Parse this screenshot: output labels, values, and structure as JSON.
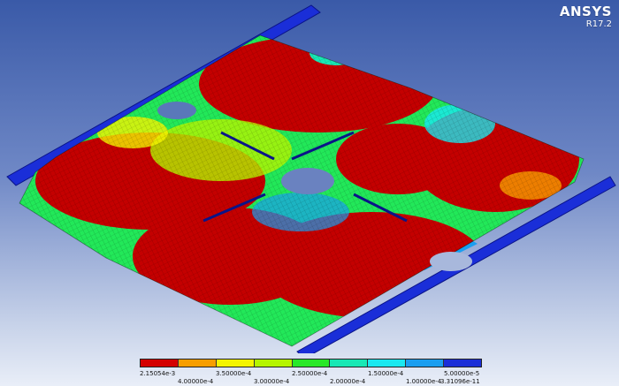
{
  "brand": {
    "name": "ANSYS",
    "version": "R17.2"
  },
  "view": {
    "icon": "fea-contour-plot"
  },
  "legend": {
    "colors": [
      "#d40000",
      "#f79e00",
      "#f4f400",
      "#b5f400",
      "#29e829",
      "#18e8b5",
      "#1ae8f0",
      "#1a9ef0",
      "#1a2ed8"
    ],
    "top_labels": [
      "2.15054e-3",
      "3.50000e-4",
      "2.50000e-4",
      "1.50000e-4",
      "5.00000e-5"
    ],
    "bottom_labels": [
      "4.00000e-4",
      "3.00000e-4",
      "2.00000e-4",
      "1.00000e-4",
      "3.31096e-11"
    ]
  }
}
